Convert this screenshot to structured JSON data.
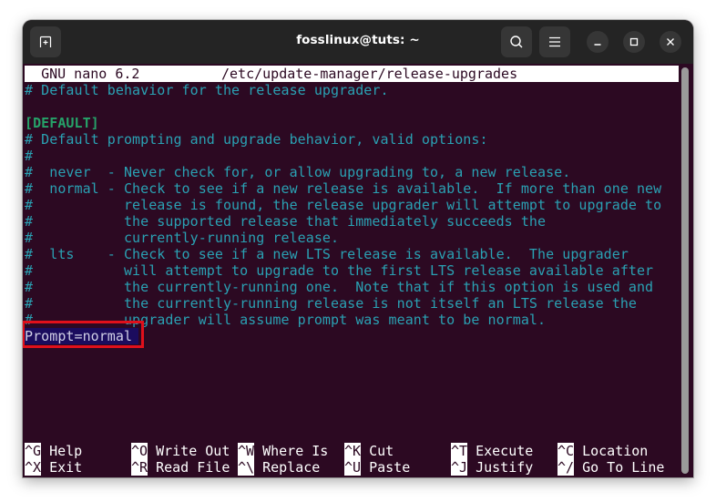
{
  "window": {
    "title": "fosslinux@tuts: ~",
    "buttons": {
      "new_tab": "new-tab",
      "search": "search",
      "menu": "menu",
      "minimize": "minimize",
      "maximize": "maximize",
      "close": "close"
    }
  },
  "nano": {
    "version_label": "GNU nano 6.2",
    "file_path": "/etc/update-manager/release-upgrades",
    "lines": [
      "# Default behavior for the release upgrader.",
      "",
      "[DEFAULT]",
      "# Default prompting and upgrade behavior, valid options:",
      "#",
      "#  never  - Never check for, or allow upgrading to, a new release.",
      "#  normal - Check to see if a new release is available.  If more than one new",
      "#           release is found, the release upgrader will attempt to upgrade to",
      "#           the supported release that immediately succeeds the",
      "#           currently-running release.",
      "#  lts    - Check to see if a new LTS release is available.  The upgrader",
      "#           will attempt to upgrade to the first LTS release available after",
      "#           the currently-running one.  Note that if this option is used and",
      "#           the currently-running release is not itself an LTS release the",
      "#           upgrader will assume prompt was meant to be normal.",
      "Prompt=normal"
    ],
    "highlighted_line": "Prompt=normal",
    "shortcuts_row1": [
      {
        "key": "^G",
        "label": "Help"
      },
      {
        "key": "^O",
        "label": "Write Out"
      },
      {
        "key": "^W",
        "label": "Where Is"
      },
      {
        "key": "^K",
        "label": "Cut"
      },
      {
        "key": "^T",
        "label": "Execute"
      },
      {
        "key": "^C",
        "label": "Location"
      }
    ],
    "shortcuts_row2": [
      {
        "key": "^X",
        "label": "Exit"
      },
      {
        "key": "^R",
        "label": "Read File"
      },
      {
        "key": "^\\",
        "label": "Replace"
      },
      {
        "key": "^U",
        "label": "Paste"
      },
      {
        "key": "^J",
        "label": "Justify"
      },
      {
        "key": "^/",
        "label": "Go To Line"
      }
    ]
  },
  "colors": {
    "terminal_bg": "#2c0922",
    "comment": "#2aa1b3",
    "section": "#26a269",
    "highlight_bg": "#1b0c5e",
    "annotation": "#e0101b",
    "titlebar": "#242424"
  }
}
